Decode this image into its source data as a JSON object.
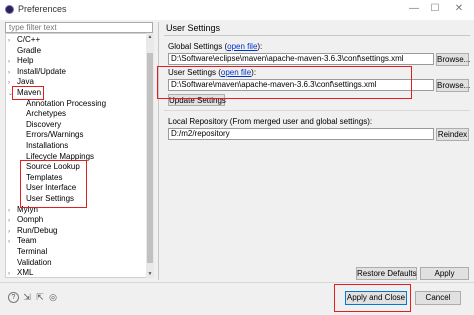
{
  "window": {
    "title": "Preferences",
    "minimize_glyph": "—",
    "maximize_glyph": "☐",
    "close_glyph": "✕"
  },
  "filter": {
    "placeholder": "type filter text"
  },
  "tree": {
    "items": [
      {
        "label": "C/C++",
        "expander": "›"
      },
      {
        "label": "Gradle",
        "expander": ""
      },
      {
        "label": "Help",
        "expander": "›"
      },
      {
        "label": "Install/Update",
        "expander": "›"
      },
      {
        "label": "Java",
        "expander": "›"
      },
      {
        "label": "Maven",
        "expander": "⌄"
      },
      {
        "label": "Annotation Processing",
        "expander": ""
      },
      {
        "label": "Archetypes",
        "expander": ""
      },
      {
        "label": "Discovery",
        "expander": ""
      },
      {
        "label": "Errors/Warnings",
        "expander": ""
      },
      {
        "label": "Installations",
        "expander": ""
      },
      {
        "label": "Lifecycle Mappings",
        "expander": ""
      },
      {
        "label": "Source Lookup",
        "expander": ""
      },
      {
        "label": "Templates",
        "expander": ""
      },
      {
        "label": "User Interface",
        "expander": ""
      },
      {
        "label": "User Settings",
        "expander": ""
      },
      {
        "label": "Mylyn",
        "expander": "›"
      },
      {
        "label": "Oomph",
        "expander": "›"
      },
      {
        "label": "Run/Debug",
        "expander": "›"
      },
      {
        "label": "Team",
        "expander": "›"
      },
      {
        "label": "Terminal",
        "expander": ""
      },
      {
        "label": "Validation",
        "expander": ""
      },
      {
        "label": "XML",
        "expander": "›"
      }
    ],
    "scroll_up_glyph": "▲",
    "scroll_down_glyph": "▼"
  },
  "panel": {
    "title": "User Settings",
    "global": {
      "label": "Global Settings (",
      "link": "open file",
      "label_end": "):",
      "value": "D:\\Software\\eclipse\\maven\\apache-maven-3.6.3\\conf\\settings.xml",
      "browse": "Browse..."
    },
    "user": {
      "label": "User Settings (",
      "link": "open file",
      "label_end": "):",
      "value": "D:\\Software\\maven\\apache-maven-3.6.3\\conf\\settings.xml",
      "browse": "Browse...",
      "update": "Update Settings"
    },
    "local": {
      "label": "Local Repository (From merged user and global settings):",
      "value": "D:/m2/repository",
      "reindex": "Reindex"
    },
    "restore_defaults": "Restore Defaults",
    "apply": "Apply"
  },
  "footer": {
    "icons": [
      "help-icon",
      "import-icon",
      "export-icon",
      "settings-icon"
    ],
    "help_glyph": "?",
    "import_glyph": "⇲",
    "export_glyph": "⇱",
    "settings_glyph": "◎",
    "apply_close": "Apply and Close",
    "cancel": "Cancel"
  },
  "colors": {
    "highlight": "#e02020",
    "link": "#0033cc",
    "default_button_border": "#0078d7"
  }
}
